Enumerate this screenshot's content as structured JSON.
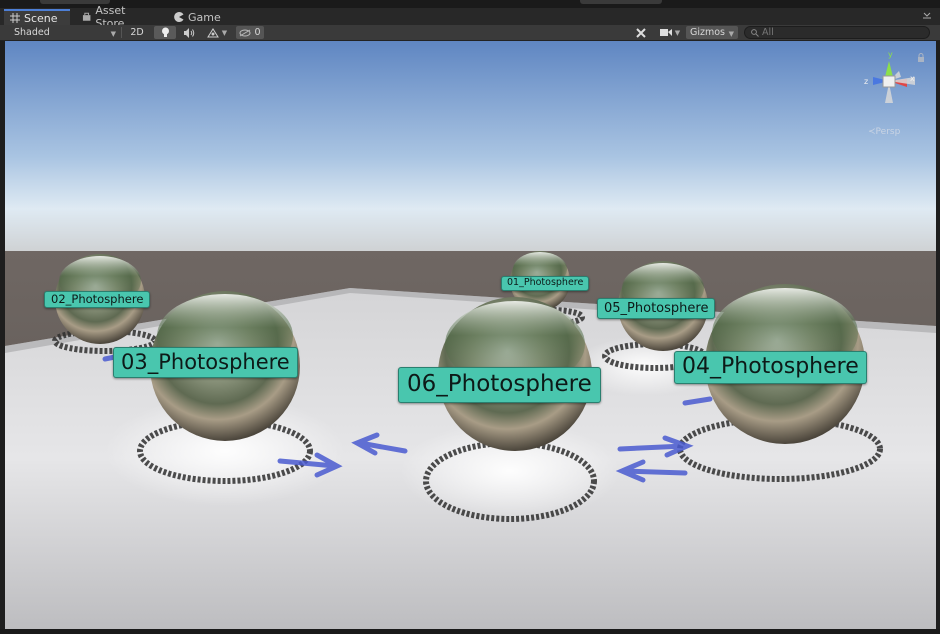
{
  "tabs": [
    {
      "label": "Scene",
      "icon": "grid-icon",
      "active": true
    },
    {
      "label": "Asset Store",
      "icon": "store-icon",
      "active": false
    },
    {
      "label": "Game",
      "icon": "pacman-icon",
      "active": false
    }
  ],
  "toolbar": {
    "shading_mode": "Shaded",
    "mode_2d": "2D",
    "hidden_count": "0",
    "gizmos_label": "Gizmos",
    "search_placeholder": "All"
  },
  "scene": {
    "objects": [
      {
        "name": "01_Photosphere"
      },
      {
        "name": "02_Photosphere"
      },
      {
        "name": "03_Photosphere"
      },
      {
        "name": "04_Photosphere"
      },
      {
        "name": "05_Photosphere"
      },
      {
        "name": "06_Photosphere"
      }
    ],
    "projection_label": "Persp",
    "gizmo_axes": {
      "y": "y",
      "x": "x",
      "z": "z"
    }
  },
  "colors": {
    "label_bg": "#49c6ae",
    "active_tab_accent": "#4d7fd6",
    "arrow_blue": "#4a5bd0"
  }
}
